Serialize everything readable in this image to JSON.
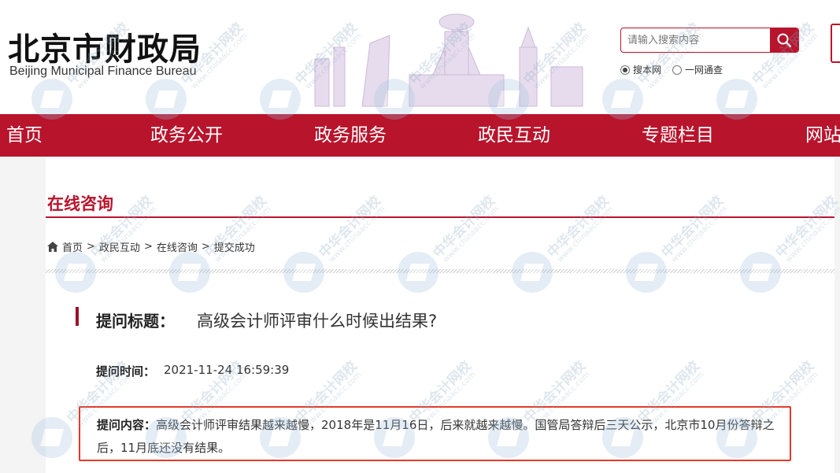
{
  "header": {
    "logo_cn": "北京市财政局",
    "logo_en": "Beijing Municipal Finance Bureau"
  },
  "search": {
    "placeholder": "请输入搜索内容",
    "options": [
      {
        "label": "搜本网",
        "selected": true
      },
      {
        "label": "一网通查",
        "selected": false
      }
    ]
  },
  "nav": {
    "items": [
      "首页",
      "政务公开",
      "政务服务",
      "政民互动",
      "专题栏目",
      "网站"
    ]
  },
  "page": {
    "section_title": "在线咨询",
    "breadcrumb": [
      "首页",
      "政民互动",
      "在线咨询",
      "提交成功"
    ],
    "breadcrumb_sep": ">"
  },
  "question": {
    "title_label": "提问标题：",
    "title": "高级会计师评审什么时候出结果?",
    "time_label": "提问时间：",
    "time": "2021-11-24 16:59:39",
    "content_label": "提问内容：",
    "content": "高级会计师评审结果越来越慢，2018年是11月16日，后来就越来越慢。国管局答辩后三天公示，北京市10月份答辩之后，11月底还没有结果。"
  },
  "watermark": {
    "text": "中华会计网校",
    "url": "www.chinaacc.com"
  },
  "colors": {
    "brand_red": "#b8142c",
    "highlight_border": "#e33a2a"
  }
}
